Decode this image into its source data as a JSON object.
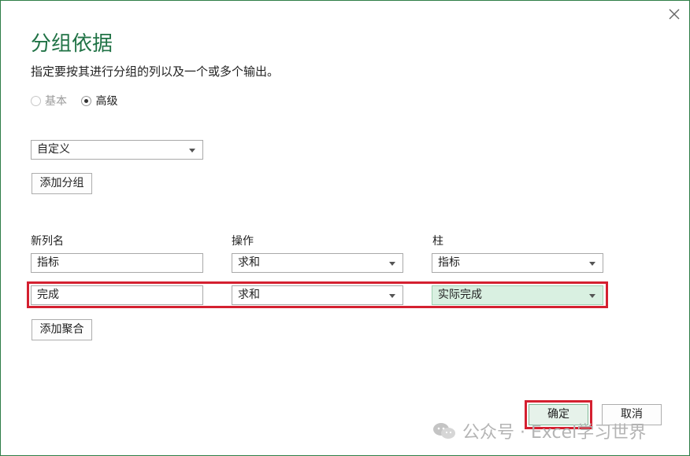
{
  "dialog": {
    "title": "分组依据",
    "subtitle": "指定要按其进行分组的列以及一个或多个输出。",
    "mode": {
      "basic_label": "基本",
      "advanced_label": "高级",
      "selected": "advanced"
    },
    "group_by": {
      "selected": "自定义",
      "add_group_label": "添加分组"
    },
    "columns": {
      "new_name": "新列名",
      "operation": "操作",
      "column": "柱"
    },
    "aggregations": [
      {
        "name": "指标",
        "operation": "求和",
        "column": "指标"
      },
      {
        "name": "完成",
        "operation": "求和",
        "column": "实际完成"
      }
    ],
    "add_aggregation_label": "添加聚合",
    "ok_label": "确定",
    "cancel_label": "取消"
  },
  "watermark": "公众号 · Excel学习世界",
  "colors": {
    "accent": "#217346",
    "highlight": "#d42030",
    "selected_field": "#d9f0e1"
  }
}
